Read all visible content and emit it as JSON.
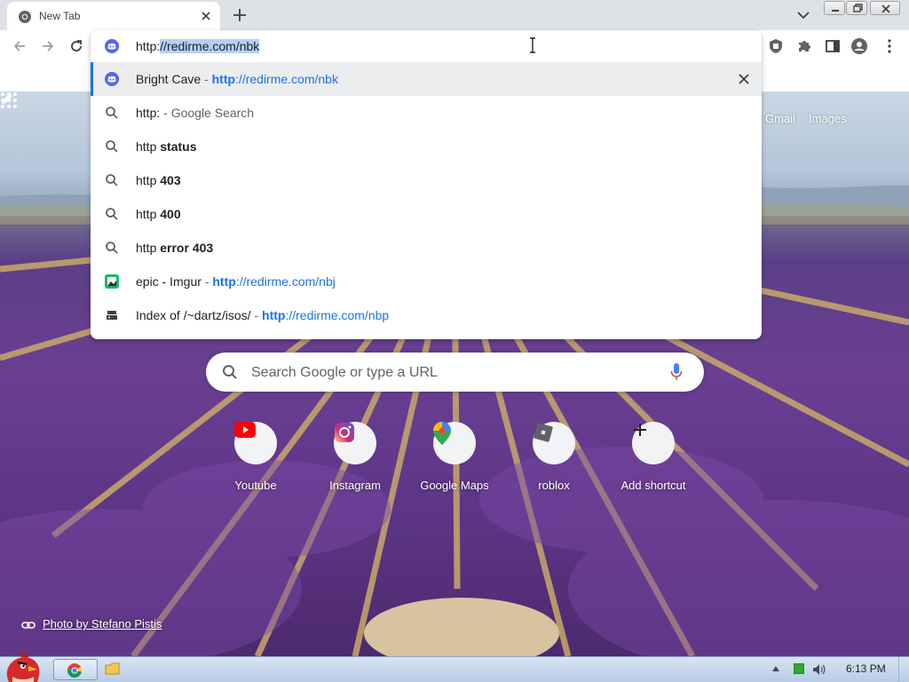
{
  "tab": {
    "title": "New Tab"
  },
  "omnibox": {
    "text_prefix": "http:",
    "text_selected": "//redirme.com/nbk"
  },
  "suggestions": [
    {
      "kind": "history",
      "icon": "discord-icon",
      "title": "Bright Cave",
      "sep": " - ",
      "url_scheme": "http",
      "url_rest": "://redirme.com/nbk",
      "removable": true
    },
    {
      "kind": "search",
      "icon": "search-icon",
      "query": "http:",
      "suffix": " - Google Search"
    },
    {
      "kind": "search",
      "icon": "search-icon",
      "prefix": "http ",
      "bold": "status"
    },
    {
      "kind": "search",
      "icon": "search-icon",
      "prefix": "http ",
      "bold": "403"
    },
    {
      "kind": "search",
      "icon": "search-icon",
      "prefix": "http ",
      "bold": "400"
    },
    {
      "kind": "search",
      "icon": "search-icon",
      "prefix": "http ",
      "bold": "error 403"
    },
    {
      "kind": "history",
      "icon": "imgur-icon",
      "title": "epic - Imgur",
      "sep": " - ",
      "url_scheme": "http",
      "url_rest": "://redirme.com/nbj"
    },
    {
      "kind": "history",
      "icon": "server-icon",
      "title": "Index of /~dartz/isos/",
      "sep": " - ",
      "url_scheme": "http",
      "url_rest": "://redirme.com/nbp"
    }
  ],
  "ntp": {
    "links": {
      "gmail": "Gmail",
      "images": "Images"
    },
    "search_placeholder": "Search Google or type a URL",
    "shortcuts": [
      {
        "label": "Youtube",
        "icon": "youtube-icon"
      },
      {
        "label": "Instagram",
        "icon": "instagram-icon"
      },
      {
        "label": "Google Maps",
        "icon": "google-maps-icon"
      },
      {
        "label": "roblox",
        "icon": "roblox-icon"
      },
      {
        "label": "Add shortcut",
        "icon": "plus-icon"
      }
    ],
    "attribution": "Photo by Stefano Pistis"
  },
  "taskbar": {
    "clock": "6:13 PM"
  },
  "colors": {
    "accent": "#1a73e8",
    "selection": "#b3d0f3",
    "lavender": "#6a3f93"
  }
}
